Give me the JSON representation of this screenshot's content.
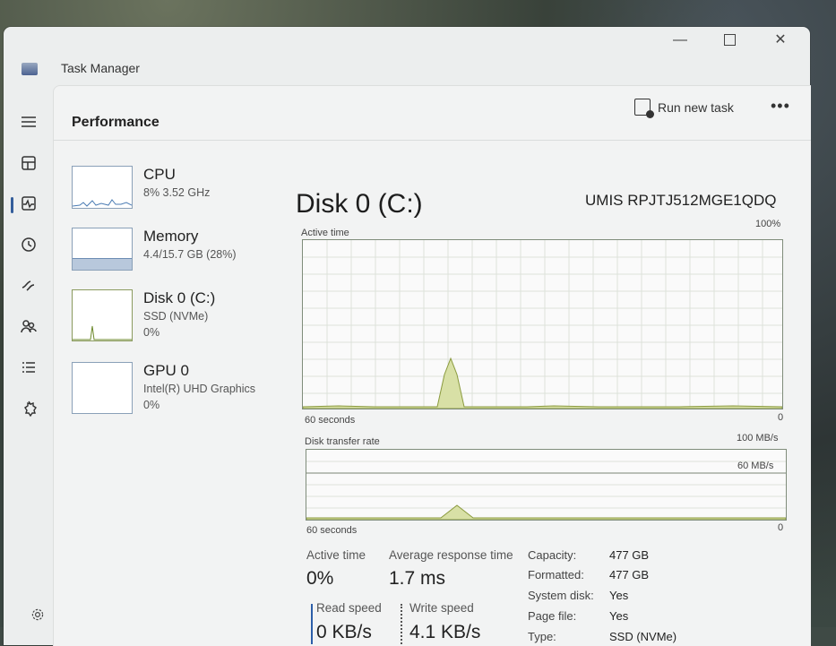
{
  "app": {
    "title": "Task Manager"
  },
  "nav": {
    "page_title": "Performance",
    "run_new_task": "Run new task",
    "more": "•••",
    "rail": [
      "hamburger-icon",
      "processes-icon",
      "performance-icon",
      "app-history-icon",
      "startup-apps-icon",
      "users-icon",
      "details-icon",
      "services-icon",
      "settings-icon"
    ]
  },
  "devices": [
    {
      "name": "CPU",
      "sub": "8% 3.52 GHz",
      "sub2": ""
    },
    {
      "name": "Memory",
      "sub": "4.4/15.7 GB (28%)",
      "sub2": ""
    },
    {
      "name": "Disk 0 (C:)",
      "sub": "SSD (NVMe)",
      "sub2": "0%"
    },
    {
      "name": "GPU 0",
      "sub": "Intel(R) UHD Graphics",
      "sub2": "0%"
    }
  ],
  "detail": {
    "title": "Disk 0 (C:)",
    "model": "UMIS RPJTJ512MGE1QDQ",
    "graph1": {
      "label": "Active time",
      "max": "100%",
      "time_label": "60 seconds",
      "min": "0"
    },
    "graph2": {
      "label": "Disk transfer rate",
      "max": "100 MB/s",
      "mid": "60 MB/s",
      "time_label": "60 seconds",
      "min": "0"
    }
  },
  "stats": {
    "active_time_label": "Active time",
    "active_time_value": "0%",
    "avg_response_label": "Average response time",
    "avg_response_value": "1.7 ms",
    "read_speed_label": "Read speed",
    "read_speed_value": "0 KB/s",
    "write_speed_label": "Write speed",
    "write_speed_value": "4.1 KB/s"
  },
  "properties": [
    {
      "label": "Capacity:",
      "value": "477 GB"
    },
    {
      "label": "Formatted:",
      "value": "477 GB"
    },
    {
      "label": "System disk:",
      "value": "Yes"
    },
    {
      "label": "Page file:",
      "value": "Yes"
    },
    {
      "label": "Type:",
      "value": "SSD (NVMe)"
    }
  ],
  "colors": {
    "disk_fill": "#d8e0a6",
    "disk_line": "#8a9a3e",
    "accent": "#2c5ea8"
  }
}
